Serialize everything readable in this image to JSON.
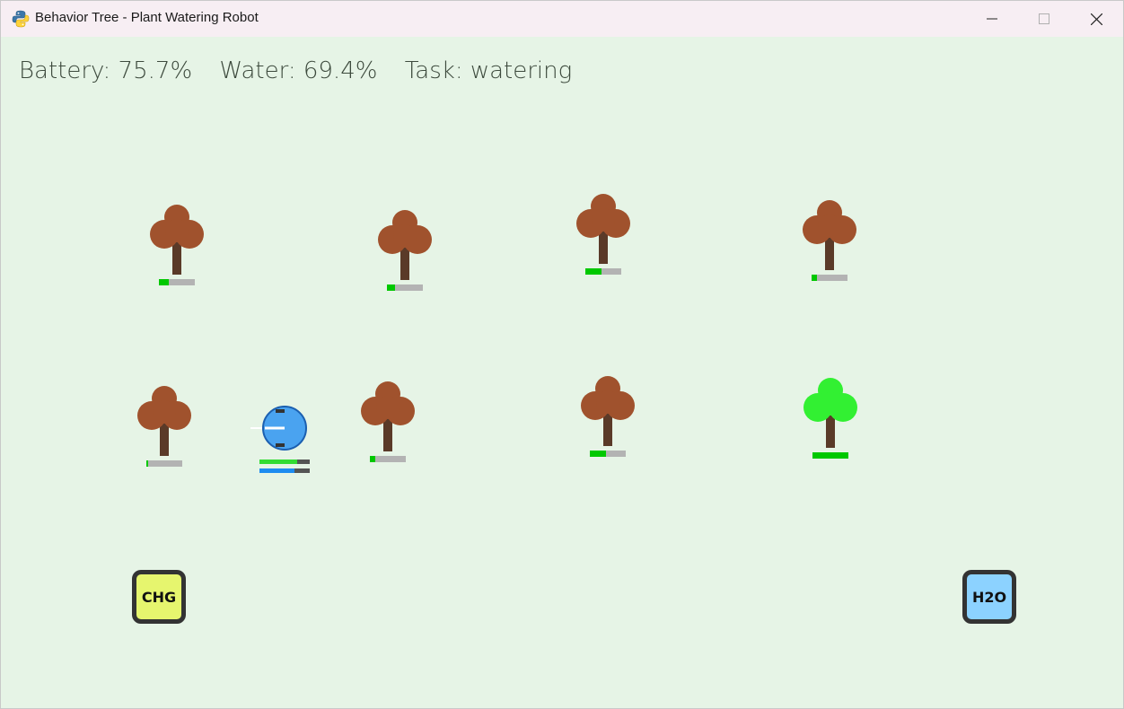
{
  "window": {
    "title": "Behavior Tree - Plant Watering Robot",
    "app_icon": "python-logo-icon"
  },
  "hud": {
    "battery": "Battery: 75.7%",
    "water": "Water: 69.4%",
    "task": "Task: watering"
  },
  "plants": [
    {
      "id": "plant-1",
      "moisture": 0.28,
      "state": "dry"
    },
    {
      "id": "plant-2",
      "moisture": 0.22,
      "state": "dry"
    },
    {
      "id": "plant-3",
      "moisture": 0.45,
      "state": "dry"
    },
    {
      "id": "plant-4",
      "moisture": 0.15,
      "state": "dry"
    },
    {
      "id": "plant-5",
      "moisture": 0.05,
      "state": "dry"
    },
    {
      "id": "plant-6",
      "moisture": 0.15,
      "state": "dry"
    },
    {
      "id": "plant-7",
      "moisture": 0.45,
      "state": "dry"
    },
    {
      "id": "plant-8",
      "moisture": 1.0,
      "state": "healthy"
    }
  ],
  "robot": {
    "battery_level": 0.757,
    "water_level": 0.694
  },
  "stations": {
    "charger": {
      "label": "CHG",
      "color": "#e6f56e"
    },
    "water": {
      "label": "H2O",
      "color": "#8cd2ff"
    }
  },
  "colors": {
    "background": "#e6f4e6",
    "dry_foliage": "#a0522d",
    "healthy_foliage": "#32f032",
    "trunk": "#5a3a28",
    "moisture_fill": "#00c800",
    "moisture_track": "#b3b3b3",
    "robot_body": "#4aa3f0",
    "robot_battery": "#32dc32",
    "robot_water": "#1e8cf0"
  }
}
